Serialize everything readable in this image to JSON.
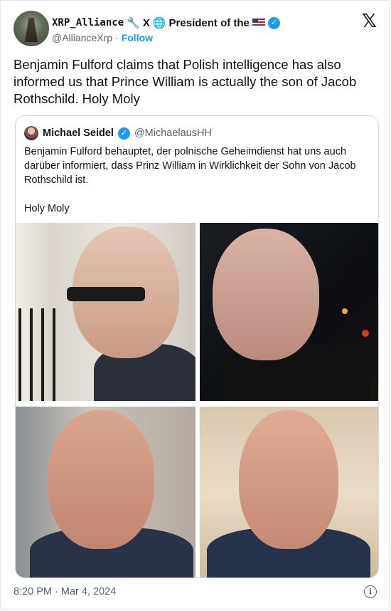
{
  "author": {
    "display_name_prefix": "XRP_Alliance",
    "name_suffix": "President of the",
    "handle": "@AllianceXrp",
    "separator": "·",
    "follow_label": "Follow"
  },
  "tweet": {
    "text": "Benjamin Fulford claims that Polish intelligence has also informed us that Prince William is actually the son of Jacob Rothschild. Holy Moly",
    "timestamp": "8:20 PM · Mar 4, 2024"
  },
  "quoted": {
    "name": "Michael Seidel",
    "handle": "@MichaelausHH",
    "text_line1": "Benjamin Fulford behauptet, der polnische Geheimdienst hat uns auch darüber informiert, dass Prinz William in Wirklichkeit der Sohn von Jacob Rothschild ist.",
    "text_line2": "Holy Moly"
  },
  "icons": {
    "x_logo": "x-logo-icon",
    "verified": "verified-badge-icon",
    "info": "info-icon",
    "wrench": "🔧",
    "globe": "🌐",
    "x_glyph": "X"
  },
  "colors": {
    "accent": "#1d9bf0",
    "secondary_text": "#536471",
    "border": "#cfd9de"
  }
}
